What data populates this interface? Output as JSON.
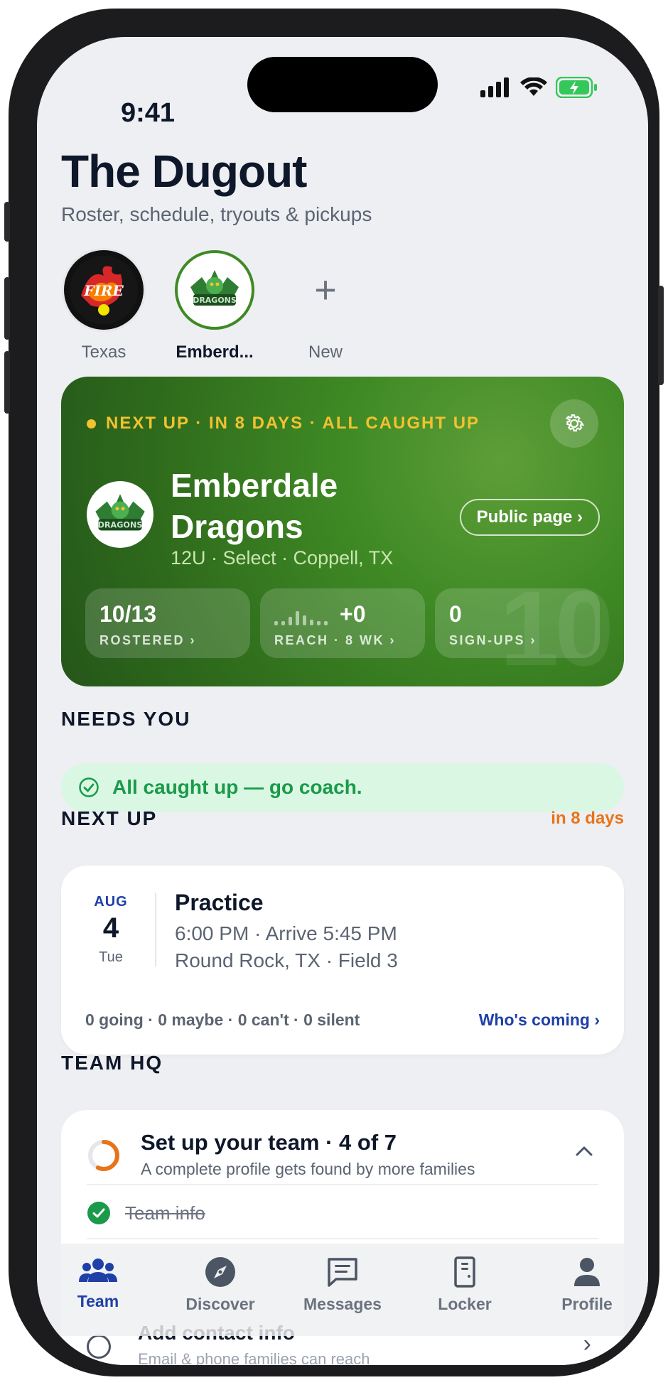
{
  "status": {
    "time": "9:41"
  },
  "header": {
    "title": "The Dugout",
    "subtitle": "Roster, schedule, tryouts & pickups"
  },
  "teams": [
    {
      "label": "Texas"
    },
    {
      "label": "Emberd..."
    },
    {
      "label": "New"
    }
  ],
  "hero": {
    "next_up": "NEXT UP · IN 8 DAYS · ALL CAUGHT UP",
    "team_name": "Emberdale Dragons",
    "meta": "12U · Select · Coppell, TX",
    "public_page": "Public page ›",
    "watermark": "10",
    "stats": [
      {
        "value": "10/13",
        "label": "ROSTERED ›"
      },
      {
        "value": "+0",
        "label": "REACH · 8 WK ›"
      },
      {
        "value": "0",
        "label": "SIGN-UPS ›"
      }
    ]
  },
  "needs_you": {
    "heading": "NEEDS YOU",
    "message": "All caught up — go coach."
  },
  "next_up": {
    "heading": "NEXT UP",
    "when": "in 8 days",
    "event": {
      "month": "AUG",
      "day": "4",
      "dow": "Tue",
      "title": "Practice",
      "time": "6:00 PM · Arrive 5:45 PM",
      "location": "Round Rock, TX · Field 3",
      "rsvp": "0 going · 0 maybe · 0 can't · 0 silent",
      "who": "Who's coming ›"
    }
  },
  "team_hq": {
    "heading": "TEAM HQ",
    "setup_title": "Set up your team · 4 of 7",
    "setup_sub": "A complete profile gets found by more families",
    "progress": 0.57,
    "done_item": "Team info",
    "contact_title": "Add contact info",
    "contact_sub": "Email & phone families can reach"
  },
  "tabs": [
    {
      "label": "Team",
      "icon": "people-icon"
    },
    {
      "label": "Discover",
      "icon": "compass-icon"
    },
    {
      "label": "Messages",
      "icon": "message-icon"
    },
    {
      "label": "Locker",
      "icon": "locker-icon"
    },
    {
      "label": "Profile",
      "icon": "person-icon"
    }
  ],
  "colors": {
    "accent": "#1e40a8",
    "hero_green": "#3f8a25",
    "gold": "#f2c230",
    "success": "#1a9a4a",
    "orange": "#e8741a"
  }
}
